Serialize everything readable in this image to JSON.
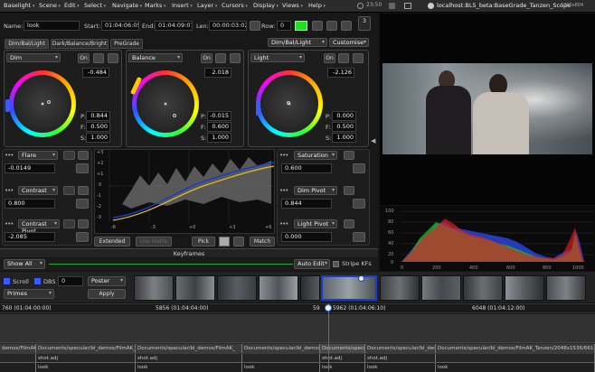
{
  "menubar": {
    "items": [
      "Baselight",
      "Scene",
      "Edit",
      "Select",
      "Navigate",
      "Marks",
      "Insert",
      "Layer",
      "Cursors",
      "Display",
      "Views",
      "Help"
    ],
    "clock": "23:50",
    "host": "localhost:BL5_beta:BaseGrade_Tanzen_Scope",
    "res": "1800x804"
  },
  "header": {
    "name_label": "Name:",
    "name_value": "look",
    "start_label": "Start:",
    "start_value": "01:04:06:05",
    "end_label": "End:",
    "end_value": "01:04:09:07",
    "len_label": "Len:",
    "len_value": "00:00:03:02",
    "row_label": "Row:",
    "row_value": "0",
    "layer_count": "3"
  },
  "tabs": {
    "dimbal": "Dim/Bal/Light",
    "dbb": "Dark/Balance/Bright",
    "pregrade": "PreGrade",
    "mode": "Dim/Bal/Light",
    "customise": "Customise"
  },
  "wheels": [
    {
      "name": "Dim",
      "on": "On",
      "value": "-0.484",
      "p": "0.844",
      "f": "0.500",
      "s": "1.000"
    },
    {
      "name": "Balance",
      "on": "On",
      "value": "2.018",
      "p": "-0.015",
      "f": "0.600",
      "s": "1.000"
    },
    {
      "name": "Light",
      "on": "On",
      "value": "-2.126",
      "p": "0.000",
      "f": "0.500",
      "s": "1.000"
    }
  ],
  "pfs": {
    "p": "P:",
    "f": "F:",
    "s": "S:"
  },
  "sliders_left": [
    {
      "name": "Flare",
      "value": "-0.0149"
    },
    {
      "name": "Contrast",
      "value": "0.800"
    },
    {
      "name": "Contrast Pivot",
      "value": "-2.085"
    }
  ],
  "sliders_right": [
    {
      "name": "Saturation",
      "value": "0.600"
    },
    {
      "name": "Dim Pivot",
      "value": "0.844"
    },
    {
      "name": "Light Pivot",
      "value": "0.000"
    }
  ],
  "curve": {
    "yticks": [
      "+3",
      "+2",
      "+1",
      "0",
      "-1",
      "-2",
      "-3"
    ],
    "xticks": [
      "-6",
      "-3",
      "+0",
      "+3",
      "+6"
    ]
  },
  "bottom_buttons": {
    "extended": "Extended",
    "use_matte": "Use Matte",
    "pick": "Pick",
    "match": "Match"
  },
  "keyframes": {
    "title": "Keyframes",
    "show_all": "Show All",
    "auto_edit": "Auto Edit",
    "stripe_kfs": "Stripe KFs"
  },
  "histogram": {
    "yticks": [
      "100",
      "80",
      "60",
      "40",
      "20",
      "0"
    ],
    "xticks": [
      "0",
      "200",
      "400",
      "600",
      "800",
      "1000"
    ]
  },
  "timeline_controls": {
    "scroll": "Scroll",
    "dbs": "DBS",
    "dbs_value": "0",
    "poster": "Poster",
    "primes": "Primes",
    "apply": "Apply"
  },
  "timecodes": [
    "760 (01:04:00:00)",
    "5856 (01:04:04:00)",
    "59",
    "5962 (01:04:06:10)",
    "6048 (01:04:12:00)"
  ],
  "tracks": {
    "files": [
      "demos/FilmAK_",
      "Documents/specular/bl_demos/FilmAK_",
      "Documents/specular/bl_demos/FilmAK_",
      "Documents/specular/bl_demos/FilmAK_Tan",
      "Documents/specular/bl_demos/FilmAK_Tanzen/70",
      "Documents/specular/bl_demos/FilmAK_",
      "Documents/specular/bl_demos/FilmAK_Tanzen/2048x1536/6615_A00"
    ],
    "shots": [
      "",
      "shot.adj",
      "shot.adj",
      "",
      "shot.adj",
      "shot.adj",
      ""
    ],
    "looks": [
      "",
      "look",
      "look",
      "look",
      "look",
      "look",
      "look"
    ]
  },
  "colors": {
    "accent": "#ffcc00",
    "green": "#22dd22",
    "blue": "#1a3ccc"
  }
}
